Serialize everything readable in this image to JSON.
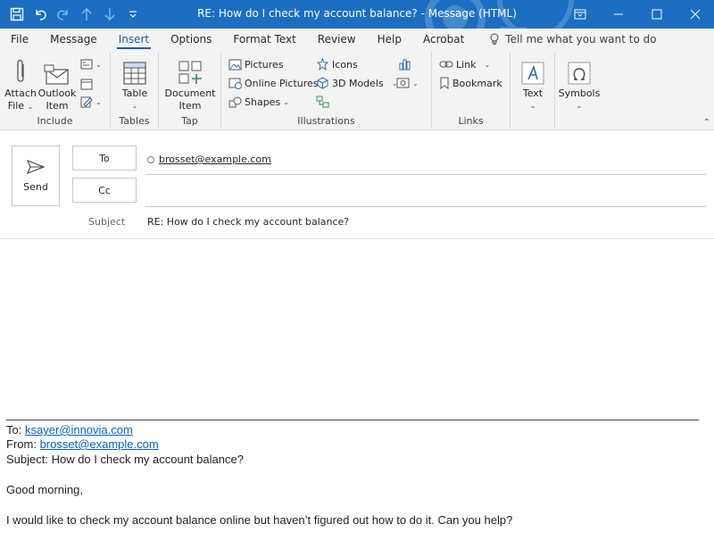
{
  "window": {
    "title": "RE: How do I check my account balance?  -  Message (HTML)"
  },
  "icons": {
    "save": "save-icon",
    "undo": "undo-icon",
    "redo": "redo-icon",
    "up": "arrow-up-icon",
    "down": "arrow-down-icon",
    "customize": "customize-qat-icon",
    "restore": "ribbon-display-icon",
    "minimize": "minimize-icon",
    "maximize": "maximize-icon",
    "close": "close-icon"
  },
  "tabs": [
    "File",
    "Message",
    "Insert",
    "Options",
    "Format Text",
    "Review",
    "Help",
    "Acrobat"
  ],
  "active_tab": "Insert",
  "tell_me": "Tell me what you want to do",
  "ribbon": {
    "include": {
      "label": "Include",
      "attach_file": [
        "Attach",
        "File"
      ],
      "outlook_item": [
        "Outlook",
        "Item"
      ]
    },
    "tables": {
      "label": "Tables",
      "table": "Table"
    },
    "tap": {
      "label": "Tap",
      "document_item": [
        "Document",
        "Item"
      ]
    },
    "illustrations": {
      "label": "Illustrations",
      "pictures": "Pictures",
      "online_pictures": "Online Pictures",
      "shapes": "Shapes",
      "icons": "Icons",
      "models_3d": "3D Models"
    },
    "links": {
      "label": "Links",
      "link": "Link",
      "bookmark": "Bookmark"
    },
    "text": {
      "text": "Text"
    },
    "symbols": {
      "symbols": "Symbols"
    }
  },
  "compose": {
    "send": "Send",
    "to_label": "To",
    "cc_label": "Cc",
    "to_recipient": "brosset@example.com",
    "subject_label": "Subject",
    "subject_value": "RE: How do I check my account balance?"
  },
  "quoted": {
    "to_prefix": "To: ",
    "to_addr": "ksayer@innovia.com",
    "from_prefix": "From: ",
    "from_addr": "brosset@example.com",
    "subject_line": "Subject: How do I check my account balance?",
    "greeting": "Good morning,",
    "body": "I would like to check my account balance online but haven’t figured out how to do it. Can you help?"
  }
}
